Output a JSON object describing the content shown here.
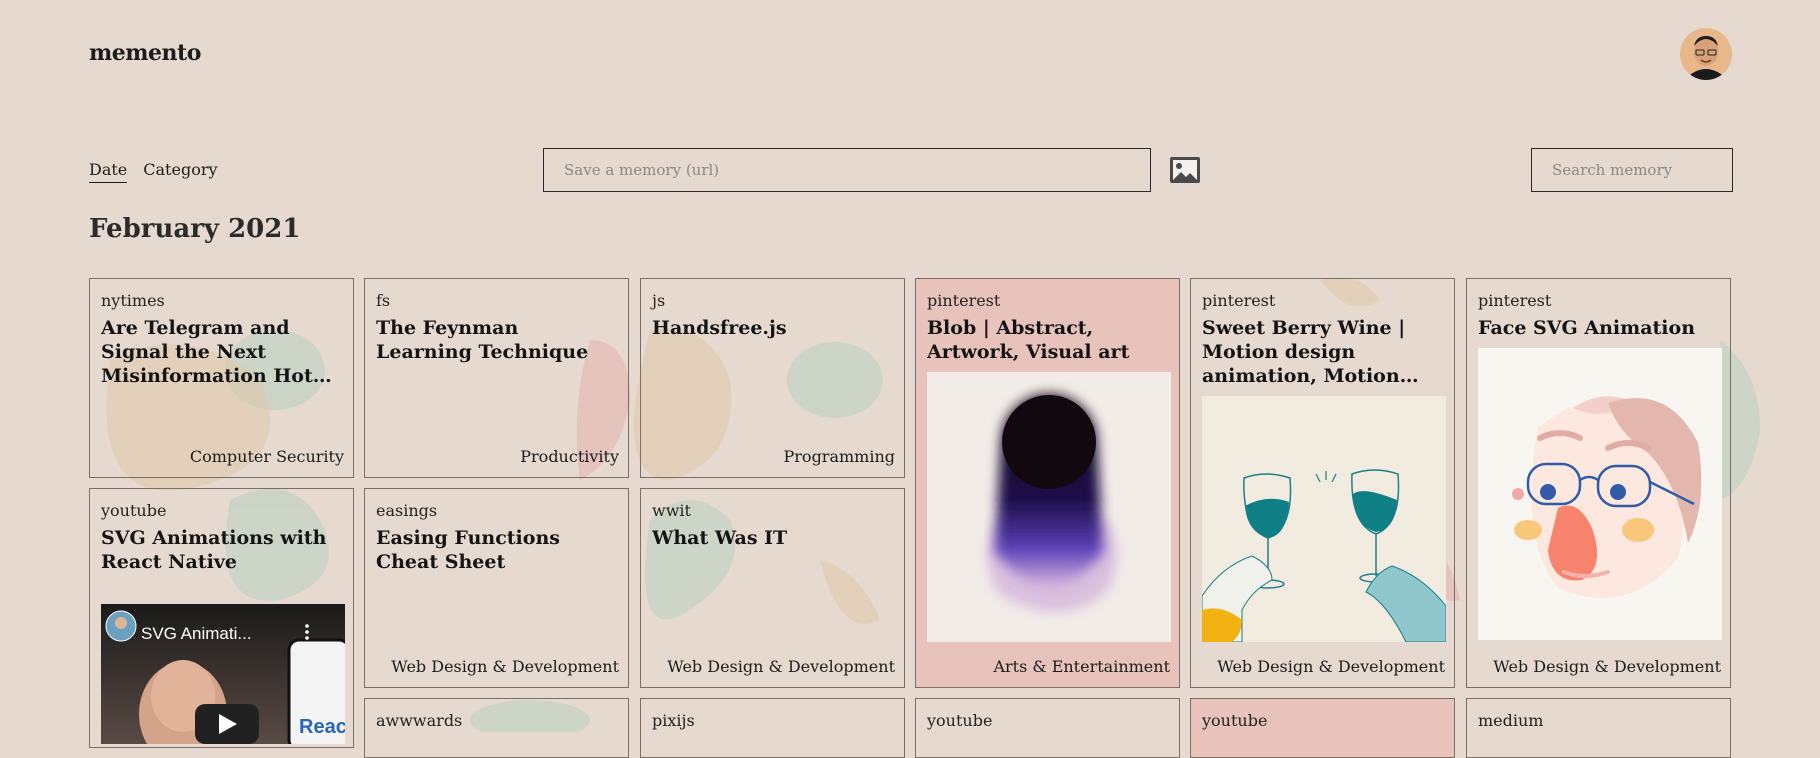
{
  "app": {
    "logo": "memento"
  },
  "toolbar": {
    "views": [
      {
        "label": "Date",
        "active": true
      },
      {
        "label": "Category",
        "active": false
      }
    ],
    "save_placeholder": "Save a memory (url)",
    "search_placeholder": "Search memory"
  },
  "section": {
    "month": "February 2021"
  },
  "cards": [
    {
      "source": "nytimes",
      "title": "Are Telegram and Signal the Next Misinformation Hot Spots? - The New York Times",
      "category": "Computer Security"
    },
    {
      "source": "fs",
      "title": "The Feynman Learning Technique",
      "category": "Productivity"
    },
    {
      "source": "js",
      "title": "Handsfree.js",
      "category": "Programming"
    },
    {
      "source": "pinterest",
      "title": "Blob | Abstract, Artwork, Visual art",
      "category": "Arts & Entertainment"
    },
    {
      "source": "pinterest",
      "title": "Sweet Berry Wine | Motion design animation, Motion graphics design, Motion graphics animation",
      "category": "Web Design & Development"
    },
    {
      "source": "pinterest",
      "title": "Face SVG Animation",
      "category": "Web Design & Development"
    },
    {
      "source": "youtube",
      "title": "SVG Animations with React Native",
      "video_title": "SVG Animati...",
      "video_sub": "Reac",
      "category": ""
    },
    {
      "source": "easings",
      "title": "Easing Functions Cheat Sheet",
      "category": "Web Design & Development"
    },
    {
      "source": "wwit",
      "title": "What Was IT",
      "category": "Web Design & Development"
    },
    {
      "source": "awwwards",
      "title": "",
      "category": ""
    },
    {
      "source": "pixijs",
      "title": "",
      "category": ""
    },
    {
      "source": "youtube",
      "title": "",
      "category": ""
    },
    {
      "source": "youtube",
      "title": "",
      "category": ""
    },
    {
      "source": "medium",
      "title": "",
      "category": ""
    }
  ],
  "colors": {
    "background": "#e6dad0",
    "border": "#7a6e66",
    "pink_card": "#e8b0ac",
    "teal": "#0f7f86",
    "blob_green": "#b8cfc1"
  }
}
